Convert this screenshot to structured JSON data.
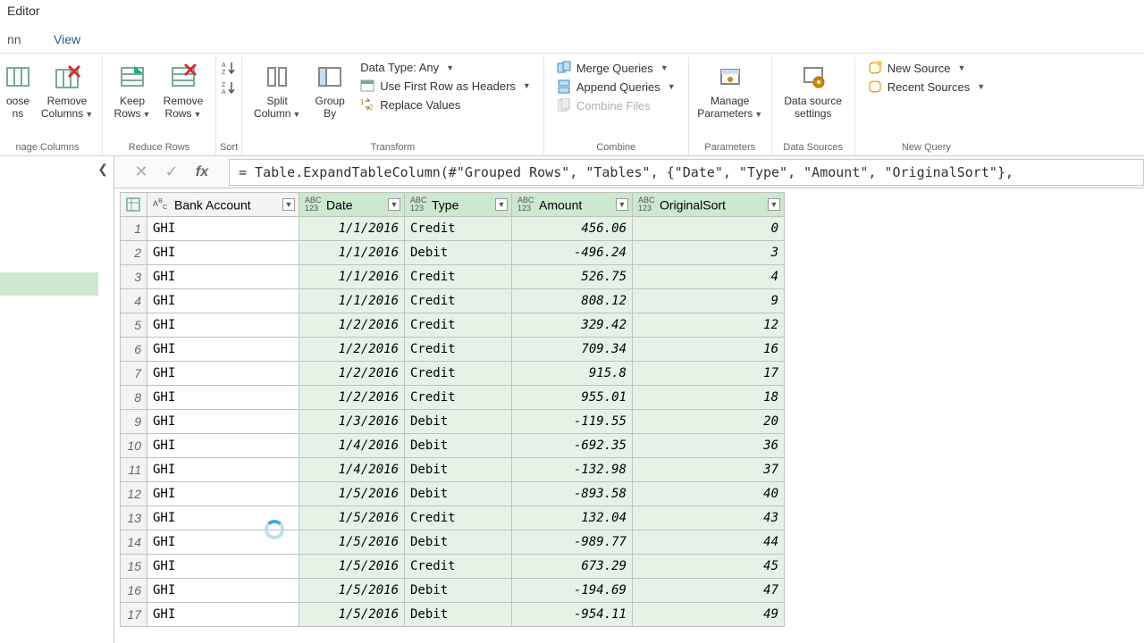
{
  "title": "Editor",
  "tabs": {
    "partial": "nn",
    "view": "View"
  },
  "ribbon": {
    "manage_cols": {
      "choose": "oose\nns",
      "remove": "Remove\nColumns",
      "label": "nage Columns"
    },
    "reduce": {
      "keep": "Keep\nRows",
      "remove": "Remove\nRows",
      "label": "Reduce Rows"
    },
    "sort": {
      "label": "Sort"
    },
    "transform": {
      "split": "Split\nColumn",
      "group": "Group\nBy",
      "datatype": "Data Type: Any",
      "firstrow": "Use First Row as Headers",
      "replace": "Replace Values",
      "label": "Transform"
    },
    "combine": {
      "merge": "Merge Queries",
      "append": "Append Queries",
      "files": "Combine Files",
      "label": "Combine"
    },
    "params": {
      "btn": "Manage\nParameters",
      "label": "Parameters"
    },
    "sources": {
      "btn": "Data source\nsettings",
      "label": "Data Sources"
    },
    "newq": {
      "new": "New Source",
      "recent": "Recent Sources",
      "label": "New Query"
    }
  },
  "formula": "= Table.ExpandTableColumn(#\"Grouped Rows\", \"Tables\", {\"Date\", \"Type\", \"Amount\", \"OriginalSort\"},",
  "columns": {
    "bank": "Bank Account",
    "date": "Date",
    "type": "Type",
    "amount": "Amount",
    "sort": "OriginalSort"
  },
  "rows": [
    {
      "n": "1",
      "bank": "GHI",
      "date": "1/1/2016",
      "type": "Credit",
      "amt": "456.06",
      "sort": "0"
    },
    {
      "n": "2",
      "bank": "GHI",
      "date": "1/1/2016",
      "type": "Debit",
      "amt": "-496.24",
      "sort": "3"
    },
    {
      "n": "3",
      "bank": "GHI",
      "date": "1/1/2016",
      "type": "Credit",
      "amt": "526.75",
      "sort": "4"
    },
    {
      "n": "4",
      "bank": "GHI",
      "date": "1/1/2016",
      "type": "Credit",
      "amt": "808.12",
      "sort": "9"
    },
    {
      "n": "5",
      "bank": "GHI",
      "date": "1/2/2016",
      "type": "Credit",
      "amt": "329.42",
      "sort": "12"
    },
    {
      "n": "6",
      "bank": "GHI",
      "date": "1/2/2016",
      "type": "Credit",
      "amt": "709.34",
      "sort": "16"
    },
    {
      "n": "7",
      "bank": "GHI",
      "date": "1/2/2016",
      "type": "Credit",
      "amt": "915.8",
      "sort": "17"
    },
    {
      "n": "8",
      "bank": "GHI",
      "date": "1/2/2016",
      "type": "Credit",
      "amt": "955.01",
      "sort": "18"
    },
    {
      "n": "9",
      "bank": "GHI",
      "date": "1/3/2016",
      "type": "Debit",
      "amt": "-119.55",
      "sort": "20"
    },
    {
      "n": "10",
      "bank": "GHI",
      "date": "1/4/2016",
      "type": "Debit",
      "amt": "-692.35",
      "sort": "36"
    },
    {
      "n": "11",
      "bank": "GHI",
      "date": "1/4/2016",
      "type": "Debit",
      "amt": "-132.98",
      "sort": "37"
    },
    {
      "n": "12",
      "bank": "GHI",
      "date": "1/5/2016",
      "type": "Debit",
      "amt": "-893.58",
      "sort": "40"
    },
    {
      "n": "13",
      "bank": "GHI",
      "date": "1/5/2016",
      "type": "Credit",
      "amt": "132.04",
      "sort": "43"
    },
    {
      "n": "14",
      "bank": "GHI",
      "date": "1/5/2016",
      "type": "Debit",
      "amt": "-989.77",
      "sort": "44"
    },
    {
      "n": "15",
      "bank": "GHI",
      "date": "1/5/2016",
      "type": "Credit",
      "amt": "673.29",
      "sort": "45"
    },
    {
      "n": "16",
      "bank": "GHI",
      "date": "1/5/2016",
      "type": "Debit",
      "amt": "-194.69",
      "sort": "47"
    },
    {
      "n": "17",
      "bank": "GHI",
      "date": "1/5/2016",
      "type": "Debit",
      "amt": "-954.11",
      "sort": "49"
    }
  ]
}
